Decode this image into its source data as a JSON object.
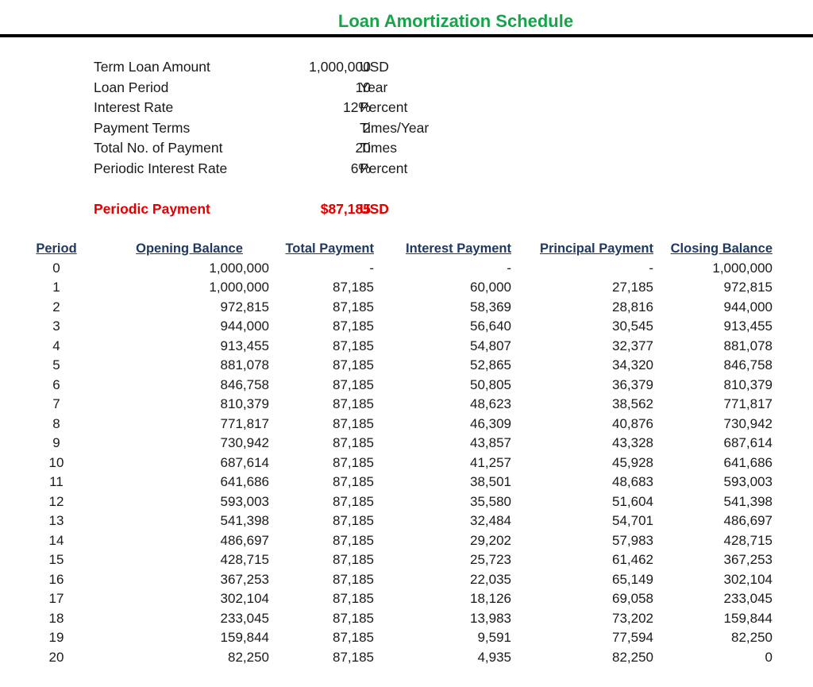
{
  "document": {
    "title": "Loan Amortization Schedule"
  },
  "parameters": [
    {
      "label": "Term Loan Amount",
      "value": "1,000,000",
      "unit": "USD"
    },
    {
      "label": "Loan Period",
      "value": "10",
      "unit": "Year"
    },
    {
      "label": "Interest Rate",
      "value": "12%",
      "unit": "Percent"
    },
    {
      "label": "Payment Terms",
      "value": "2",
      "unit": "Times/Year"
    },
    {
      "label": "Total No. of Payment",
      "value": "20",
      "unit": "Times"
    },
    {
      "label": "Periodic Interest Rate",
      "value": "6%",
      "unit": "Percent"
    }
  ],
  "periodic_payment": {
    "label": "Periodic Payment",
    "value": "$87,185",
    "unit": "USD"
  },
  "colors": {
    "title": "#17a34a",
    "highlight": "#e00000",
    "header": "#1f3864"
  },
  "schedule": {
    "columns": [
      "Period",
      "Opening Balance",
      "Total Payment",
      "Interest Payment",
      "Principal Payment",
      "Closing Balance"
    ],
    "rows": [
      [
        "0",
        "1,000,000",
        "-",
        "-",
        "-",
        "1,000,000"
      ],
      [
        "1",
        "1,000,000",
        "87,185",
        "60,000",
        "27,185",
        "972,815"
      ],
      [
        "2",
        "972,815",
        "87,185",
        "58,369",
        "28,816",
        "944,000"
      ],
      [
        "3",
        "944,000",
        "87,185",
        "56,640",
        "30,545",
        "913,455"
      ],
      [
        "4",
        "913,455",
        "87,185",
        "54,807",
        "32,377",
        "881,078"
      ],
      [
        "5",
        "881,078",
        "87,185",
        "52,865",
        "34,320",
        "846,758"
      ],
      [
        "6",
        "846,758",
        "87,185",
        "50,805",
        "36,379",
        "810,379"
      ],
      [
        "7",
        "810,379",
        "87,185",
        "48,623",
        "38,562",
        "771,817"
      ],
      [
        "8",
        "771,817",
        "87,185",
        "46,309",
        "40,876",
        "730,942"
      ],
      [
        "9",
        "730,942",
        "87,185",
        "43,857",
        "43,328",
        "687,614"
      ],
      [
        "10",
        "687,614",
        "87,185",
        "41,257",
        "45,928",
        "641,686"
      ],
      [
        "11",
        "641,686",
        "87,185",
        "38,501",
        "48,683",
        "593,003"
      ],
      [
        "12",
        "593,003",
        "87,185",
        "35,580",
        "51,604",
        "541,398"
      ],
      [
        "13",
        "541,398",
        "87,185",
        "32,484",
        "54,701",
        "486,697"
      ],
      [
        "14",
        "486,697",
        "87,185",
        "29,202",
        "57,983",
        "428,715"
      ],
      [
        "15",
        "428,715",
        "87,185",
        "25,723",
        "61,462",
        "367,253"
      ],
      [
        "16",
        "367,253",
        "87,185",
        "22,035",
        "65,149",
        "302,104"
      ],
      [
        "17",
        "302,104",
        "87,185",
        "18,126",
        "69,058",
        "233,045"
      ],
      [
        "18",
        "233,045",
        "87,185",
        "13,983",
        "73,202",
        "159,844"
      ],
      [
        "19",
        "159,844",
        "87,185",
        "9,591",
        "77,594",
        "82,250"
      ],
      [
        "20",
        "82,250",
        "87,185",
        "4,935",
        "82,250",
        "0"
      ]
    ]
  }
}
